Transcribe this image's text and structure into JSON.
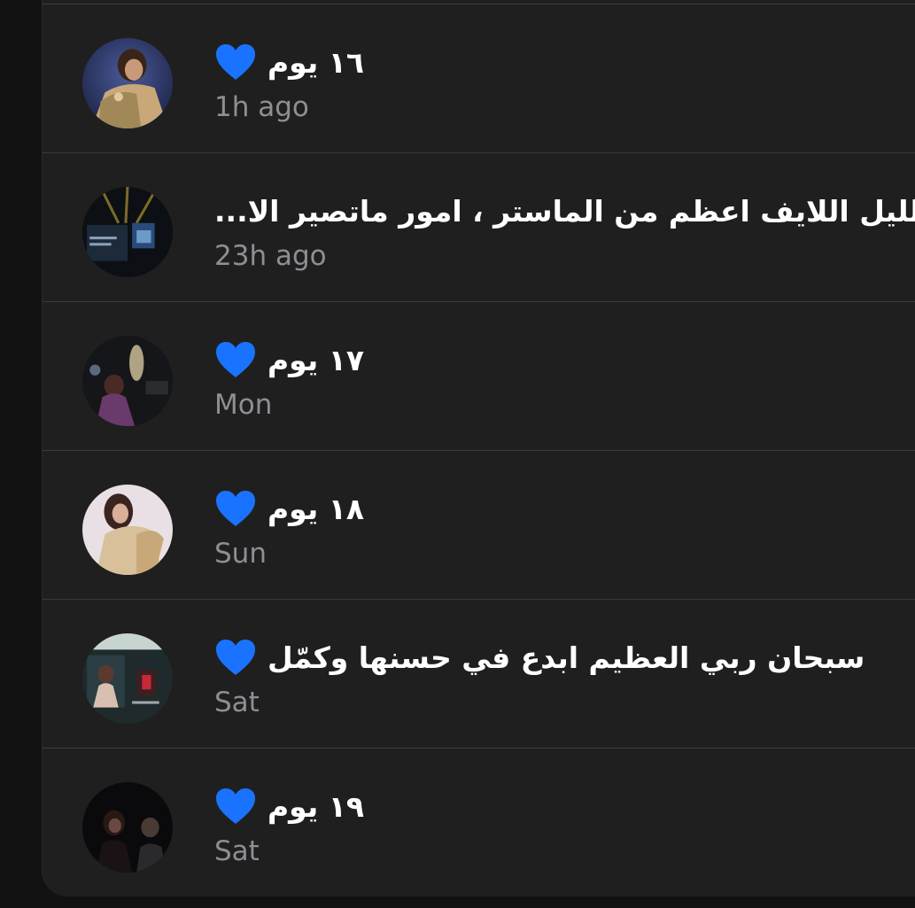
{
  "colors": {
    "panel_bg": "#1f1f20",
    "divider": "#3a3a3c",
    "title_text": "#ffffff",
    "time_text": "#8e8e93",
    "heart": "#1a73ff"
  },
  "items": [
    {
      "title": "١٦ يوم",
      "heart": true,
      "heart_icon": "blue-heart-icon",
      "time": "1h ago"
    },
    {
      "title": "باب الليل اللايف اعظم من الماستر ، امور ماتصير الا...",
      "heart": false,
      "time": "23h ago"
    },
    {
      "title": "١٧ يوم",
      "heart": true,
      "heart_icon": "blue-heart-icon",
      "time": "Mon"
    },
    {
      "title": "١٨ يوم",
      "heart": true,
      "heart_icon": "blue-heart-icon",
      "time": "Sun"
    },
    {
      "title": "سبحان ربي العظيم ابدع في حسنها وكمّل",
      "heart": true,
      "heart_icon": "blue-heart-icon",
      "time": "Sat"
    },
    {
      "title": "١٩ يوم",
      "heart": true,
      "heart_icon": "blue-heart-icon",
      "time": "Sat"
    }
  ]
}
